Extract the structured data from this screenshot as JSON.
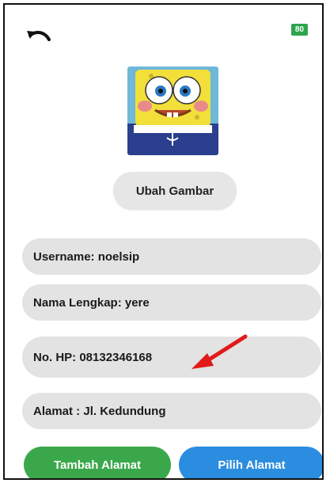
{
  "header": {
    "back_icon": "undo-arrow-icon",
    "badge_value": "80",
    "badge_color": "#2ea44f"
  },
  "profile": {
    "avatar_icon": "sponge-cartoon-avatar",
    "change_image_label": "Ubah Gambar"
  },
  "fields": {
    "username": "Username: noelsip",
    "full_name": "Nama Lengkap: yere",
    "phone": "No. HP: 08132346168",
    "address": "Alamat : Jl. Kedundung"
  },
  "actions": {
    "add_address_label": "Tambah Alamat",
    "choose_address_label": "Pilih Alamat",
    "add_color": "#3aa84a",
    "choose_color": "#2b8de0"
  },
  "annotation": {
    "arrow_icon": "red-arrow-icon",
    "arrow_color": "#e01b1b"
  }
}
